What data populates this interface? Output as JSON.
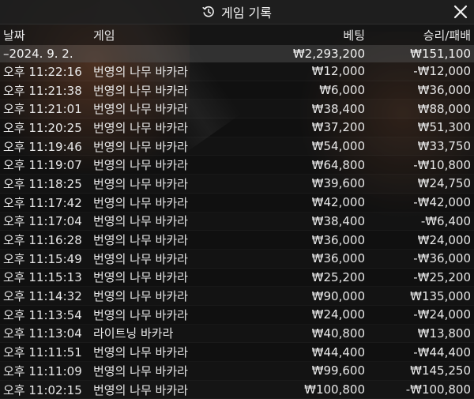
{
  "title": "게임 기록",
  "icons": {
    "title_icon": "history-icon",
    "close": "close-icon"
  },
  "columns": {
    "date": "날짜",
    "game": "게임",
    "bet": "베팅",
    "win_loss": "승리/패배"
  },
  "summary": {
    "date": "–2024. 9. 2.",
    "bet": "₩2,293,200",
    "win_loss": "₩151,100"
  },
  "rows": [
    {
      "time": "오후 11:22:16",
      "game": "번영의 나무 바카라",
      "bet": "₩12,000",
      "win_loss": "-₩12,000"
    },
    {
      "time": "오후 11:21:38",
      "game": "번영의 나무 바카라",
      "bet": "₩6,000",
      "win_loss": "₩36,000"
    },
    {
      "time": "오후 11:21:01",
      "game": "번영의 나무 바카라",
      "bet": "₩38,400",
      "win_loss": "₩88,000"
    },
    {
      "time": "오후 11:20:25",
      "game": "번영의 나무 바카라",
      "bet": "₩37,200",
      "win_loss": "₩51,300"
    },
    {
      "time": "오후 11:19:46",
      "game": "번영의 나무 바카라",
      "bet": "₩54,000",
      "win_loss": "₩33,750"
    },
    {
      "time": "오후 11:19:07",
      "game": "번영의 나무 바카라",
      "bet": "₩64,800",
      "win_loss": "-₩10,800"
    },
    {
      "time": "오후 11:18:25",
      "game": "번영의 나무 바카라",
      "bet": "₩39,600",
      "win_loss": "₩24,750"
    },
    {
      "time": "오후 11:17:42",
      "game": "번영의 나무 바카라",
      "bet": "₩42,000",
      "win_loss": "-₩42,000"
    },
    {
      "time": "오후 11:17:04",
      "game": "번영의 나무 바카라",
      "bet": "₩38,400",
      "win_loss": "-₩6,400"
    },
    {
      "time": "오후 11:16:28",
      "game": "번영의 나무 바카라",
      "bet": "₩36,000",
      "win_loss": "₩24,000"
    },
    {
      "time": "오후 11:15:49",
      "game": "번영의 나무 바카라",
      "bet": "₩36,000",
      "win_loss": "-₩36,000"
    },
    {
      "time": "오후 11:15:13",
      "game": "번영의 나무 바카라",
      "bet": "₩25,200",
      "win_loss": "-₩25,200"
    },
    {
      "time": "오후 11:14:32",
      "game": "번영의 나무 바카라",
      "bet": "₩90,000",
      "win_loss": "₩135,000"
    },
    {
      "time": "오후 11:13:54",
      "game": "번영의 나무 바카라",
      "bet": "₩24,000",
      "win_loss": "-₩24,000"
    },
    {
      "time": "오후 11:13:04",
      "game": "라이트닝 바카라",
      "bet": "₩40,800",
      "win_loss": "₩13,800"
    },
    {
      "time": "오후 11:11:51",
      "game": "번영의 나무 바카라",
      "bet": "₩44,400",
      "win_loss": "-₩44,400"
    },
    {
      "time": "오후 11:11:09",
      "game": "번영의 나무 바카라",
      "bet": "₩99,600",
      "win_loss": "₩145,250"
    },
    {
      "time": "오후 11:02:15",
      "game": "번영의 나무 바카라",
      "bet": "₩100,800",
      "win_loss": "-₩100,800"
    }
  ]
}
